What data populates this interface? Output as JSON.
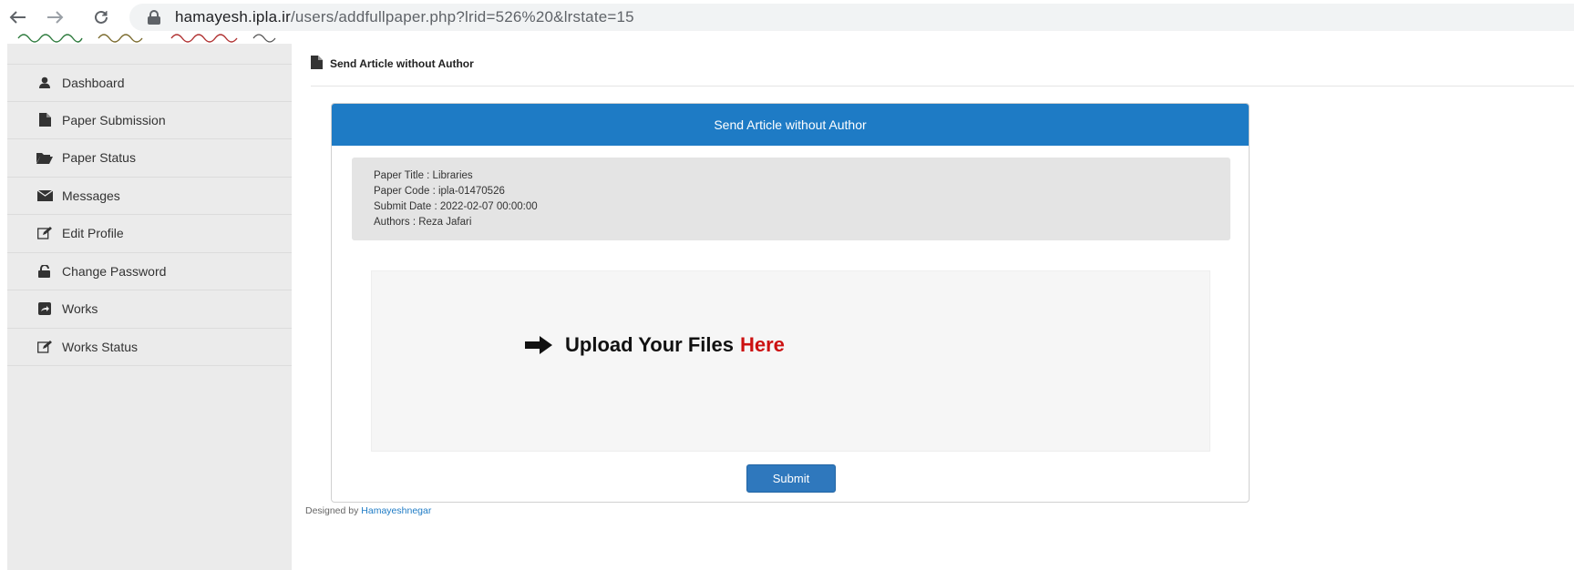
{
  "browser": {
    "back_icon": "back-arrow-icon",
    "forward_icon": "forward-arrow-icon",
    "reload_icon": "reload-icon",
    "url_host": "hamayesh.ipla.ir",
    "url_path": "/users/addfullpaper.php?lrid=526%20&lrstate=15"
  },
  "sidebar": {
    "items": [
      {
        "label": "Dashboard",
        "icon": "user-icon"
      },
      {
        "label": "Paper Submission",
        "icon": "file-icon"
      },
      {
        "label": "Paper Status",
        "icon": "folder-open-icon"
      },
      {
        "label": "Messages",
        "icon": "envelope-icon"
      },
      {
        "label": "Edit Profile",
        "icon": "edit-icon"
      },
      {
        "label": "Change Password",
        "icon": "unlock-icon"
      },
      {
        "label": "Works",
        "icon": "share-icon"
      },
      {
        "label": "Works Status",
        "icon": "edit-icon"
      }
    ]
  },
  "page": {
    "heading": "Send Article without Author"
  },
  "panel": {
    "title": "Send Article without Author",
    "info": {
      "paper_title": "Paper Title : Libraries",
      "paper_code": "Paper Code : ipla-01470526",
      "submit_date": "Submit Date : 2022-02-07 00:00:00",
      "authors": "Authors : Reza Jafari"
    },
    "upload": {
      "text": "Upload Your Files",
      "highlight": "Here"
    },
    "submit_label": "Submit"
  },
  "footer": {
    "prefix": "Designed by",
    "link": "Hamayeshnegar"
  },
  "colors": {
    "panel_header": "#1e7bc5",
    "submit_button": "#2f78bd",
    "highlight": "#cc1111",
    "sidebar_bg": "#ebebeb"
  }
}
